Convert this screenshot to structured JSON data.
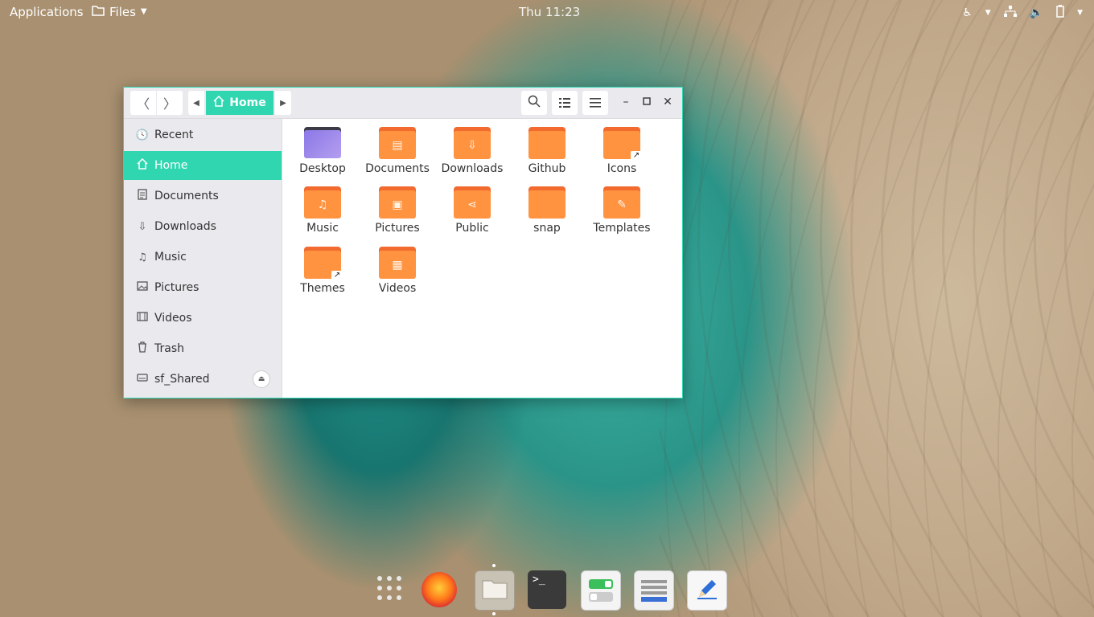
{
  "topbar": {
    "applications": "Applications",
    "files_menu": "Files",
    "clock": "Thu 11:23"
  },
  "window": {
    "path_current": "Home",
    "sidebar": {
      "items": [
        {
          "label": "Recent",
          "icon": "clock-icon"
        },
        {
          "label": "Home",
          "icon": "home-icon"
        },
        {
          "label": "Documents",
          "icon": "document-icon"
        },
        {
          "label": "Downloads",
          "icon": "download-icon"
        },
        {
          "label": "Music",
          "icon": "music-icon"
        },
        {
          "label": "Pictures",
          "icon": "picture-icon"
        },
        {
          "label": "Videos",
          "icon": "film-icon"
        },
        {
          "label": "Trash",
          "icon": "trash-icon"
        },
        {
          "label": "sf_Shared",
          "icon": "drive-icon"
        }
      ]
    },
    "folders": [
      {
        "label": "Desktop"
      },
      {
        "label": "Documents"
      },
      {
        "label": "Downloads"
      },
      {
        "label": "Github"
      },
      {
        "label": "Icons"
      },
      {
        "label": "Music"
      },
      {
        "label": "Pictures"
      },
      {
        "label": "Public"
      },
      {
        "label": "snap"
      },
      {
        "label": "Templates"
      },
      {
        "label": "Themes"
      },
      {
        "label": "Videos"
      }
    ]
  },
  "colors": {
    "accent": "#2fd6b0",
    "folder": "#ff9340",
    "folder_tab": "#f26a2e"
  },
  "dock": {
    "terminal_prompt": ">_"
  }
}
